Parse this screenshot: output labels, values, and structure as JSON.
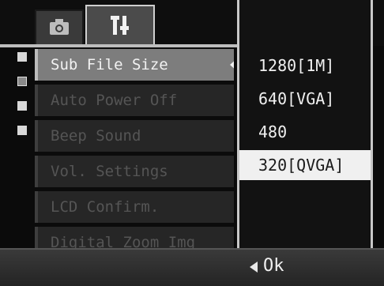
{
  "tabs": [
    {
      "icon": "camera-icon"
    },
    {
      "icon": "setup-icon"
    }
  ],
  "menu": {
    "items": [
      {
        "label": "Sub File Size",
        "selected": true
      },
      {
        "label": "Auto Power Off",
        "selected": false
      },
      {
        "label": "Beep Sound",
        "selected": false
      },
      {
        "label": "Vol. Settings",
        "selected": false
      },
      {
        "label": "LCD Confirm.",
        "selected": false
      },
      {
        "label": "Digital Zoom Img",
        "selected": false
      }
    ]
  },
  "dropdown": {
    "options": [
      "1280[1M]",
      "640[VGA]",
      "480",
      "320[QVGA]"
    ],
    "selected_index": 3
  },
  "footer": {
    "ok_label": "Ok"
  },
  "colors": {
    "selected_bg": "#7d7d7d",
    "dropdown_selected_bg": "#f0f0f0"
  }
}
